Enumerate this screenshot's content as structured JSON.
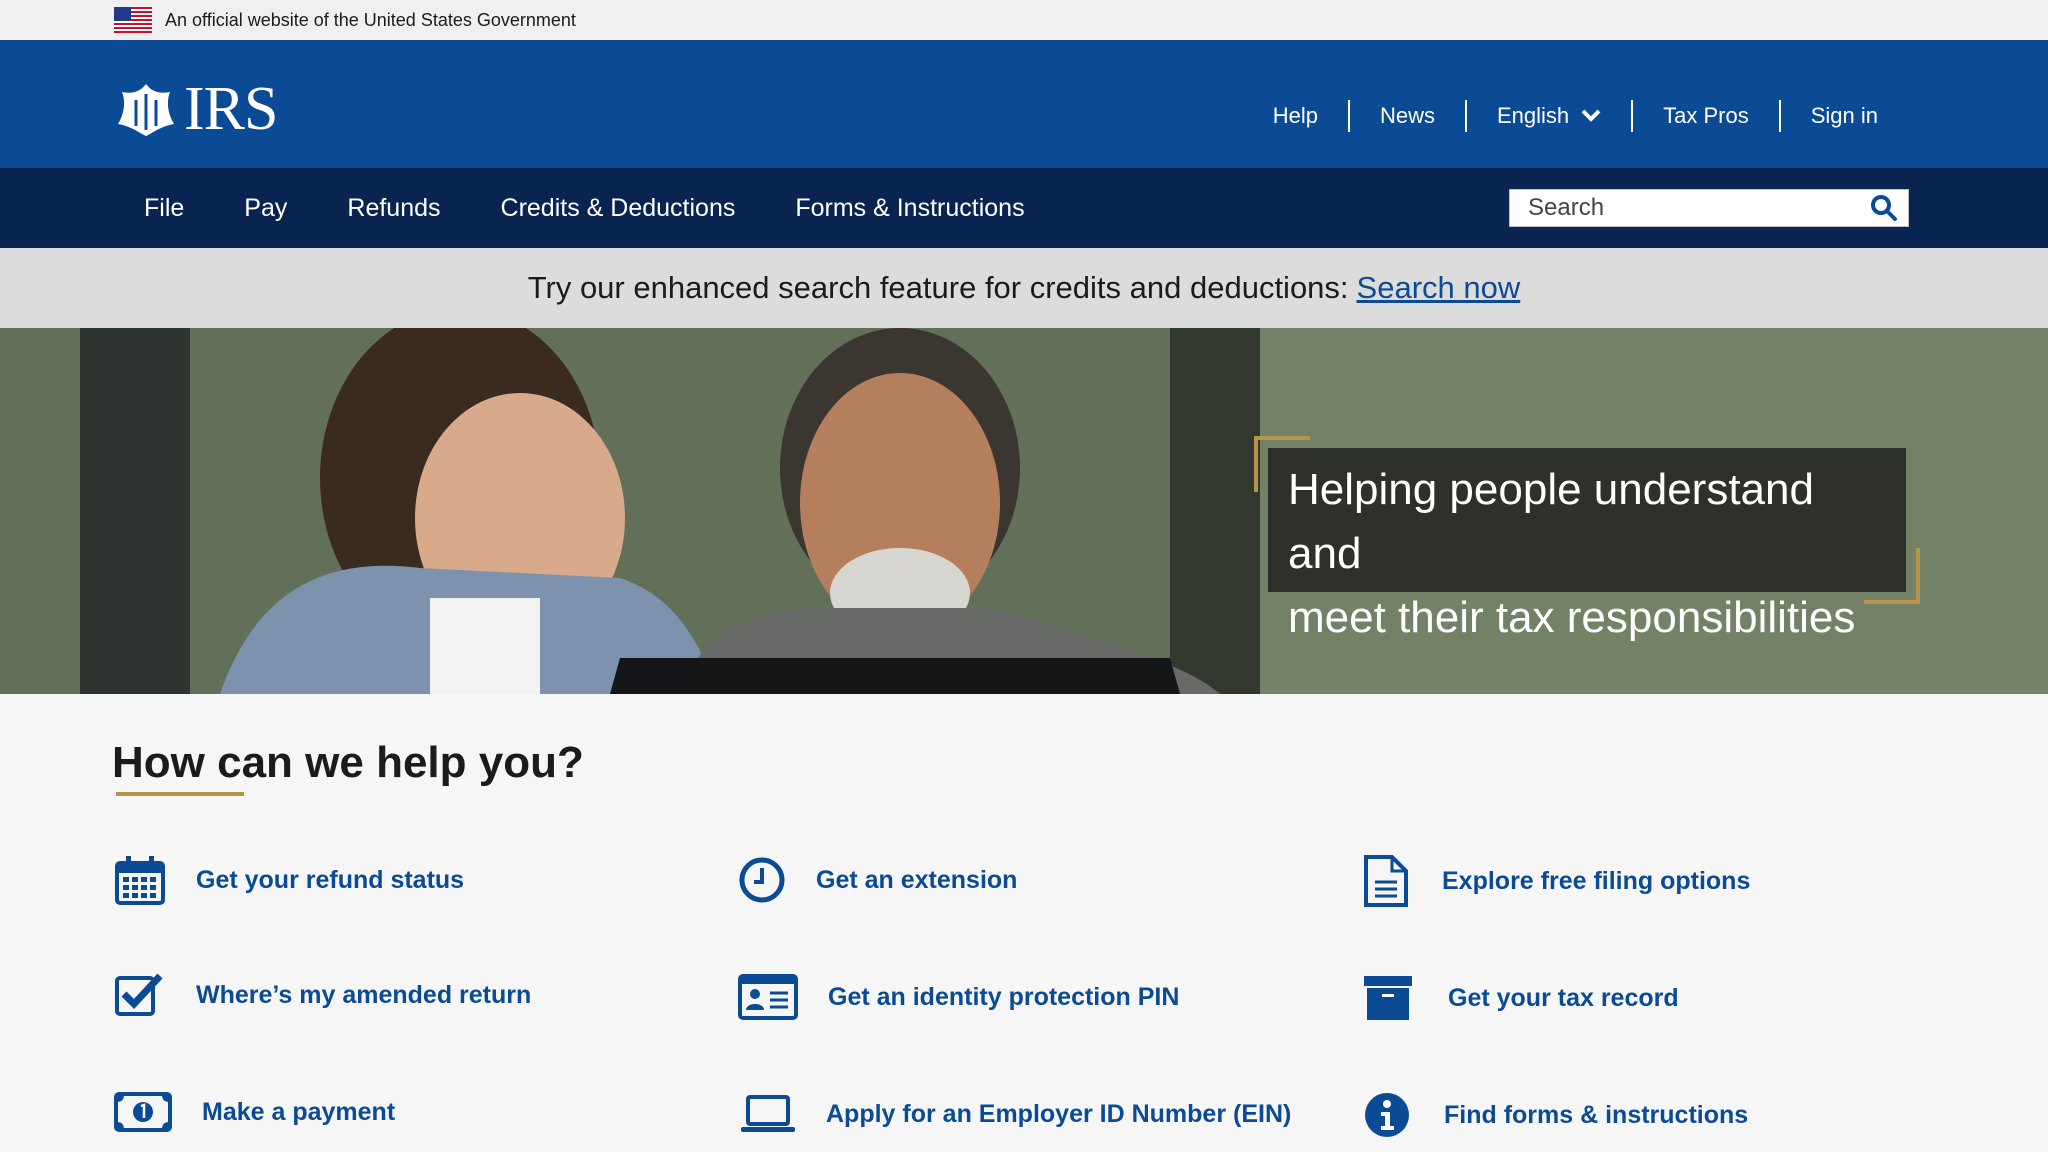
{
  "gov_banner": {
    "text": "An official website of the United States Government"
  },
  "header": {
    "logo_text": "IRS",
    "top_links": [
      "Help",
      "News",
      "English",
      "Tax Pros",
      "Sign in"
    ]
  },
  "nav": {
    "items": [
      "File",
      "Pay",
      "Refunds",
      "Credits & Deductions",
      "Forms & Instructions"
    ],
    "search_placeholder": "Search"
  },
  "announcement": {
    "text": "Try our enhanced search feature for credits and deductions:",
    "link": "Search now"
  },
  "hero": {
    "line1": "Helping people understand and",
    "line2": "meet their tax responsibilities"
  },
  "help": {
    "title": "How can we help you?",
    "tasks": [
      {
        "label": "Get your refund status",
        "icon": "calendar-icon"
      },
      {
        "label": "Get an extension",
        "icon": "clock-icon"
      },
      {
        "label": "Explore free filing options",
        "icon": "document-icon"
      },
      {
        "label": "Where’s my amended return",
        "icon": "checkbox-icon"
      },
      {
        "label": "Get an identity protection PIN",
        "icon": "id-card-icon"
      },
      {
        "label": "Get your tax record",
        "icon": "archive-box-icon"
      },
      {
        "label": "Make a payment",
        "icon": "money-bill-icon"
      },
      {
        "label": "Apply for an Employer ID Number (EIN)",
        "icon": "laptop-icon"
      },
      {
        "label": "Find forms & instructions",
        "icon": "info-icon"
      }
    ]
  },
  "colors": {
    "brand_blue": "#0b4a95",
    "nav_dark": "#0a2452",
    "accent_gold": "#b8934a"
  }
}
